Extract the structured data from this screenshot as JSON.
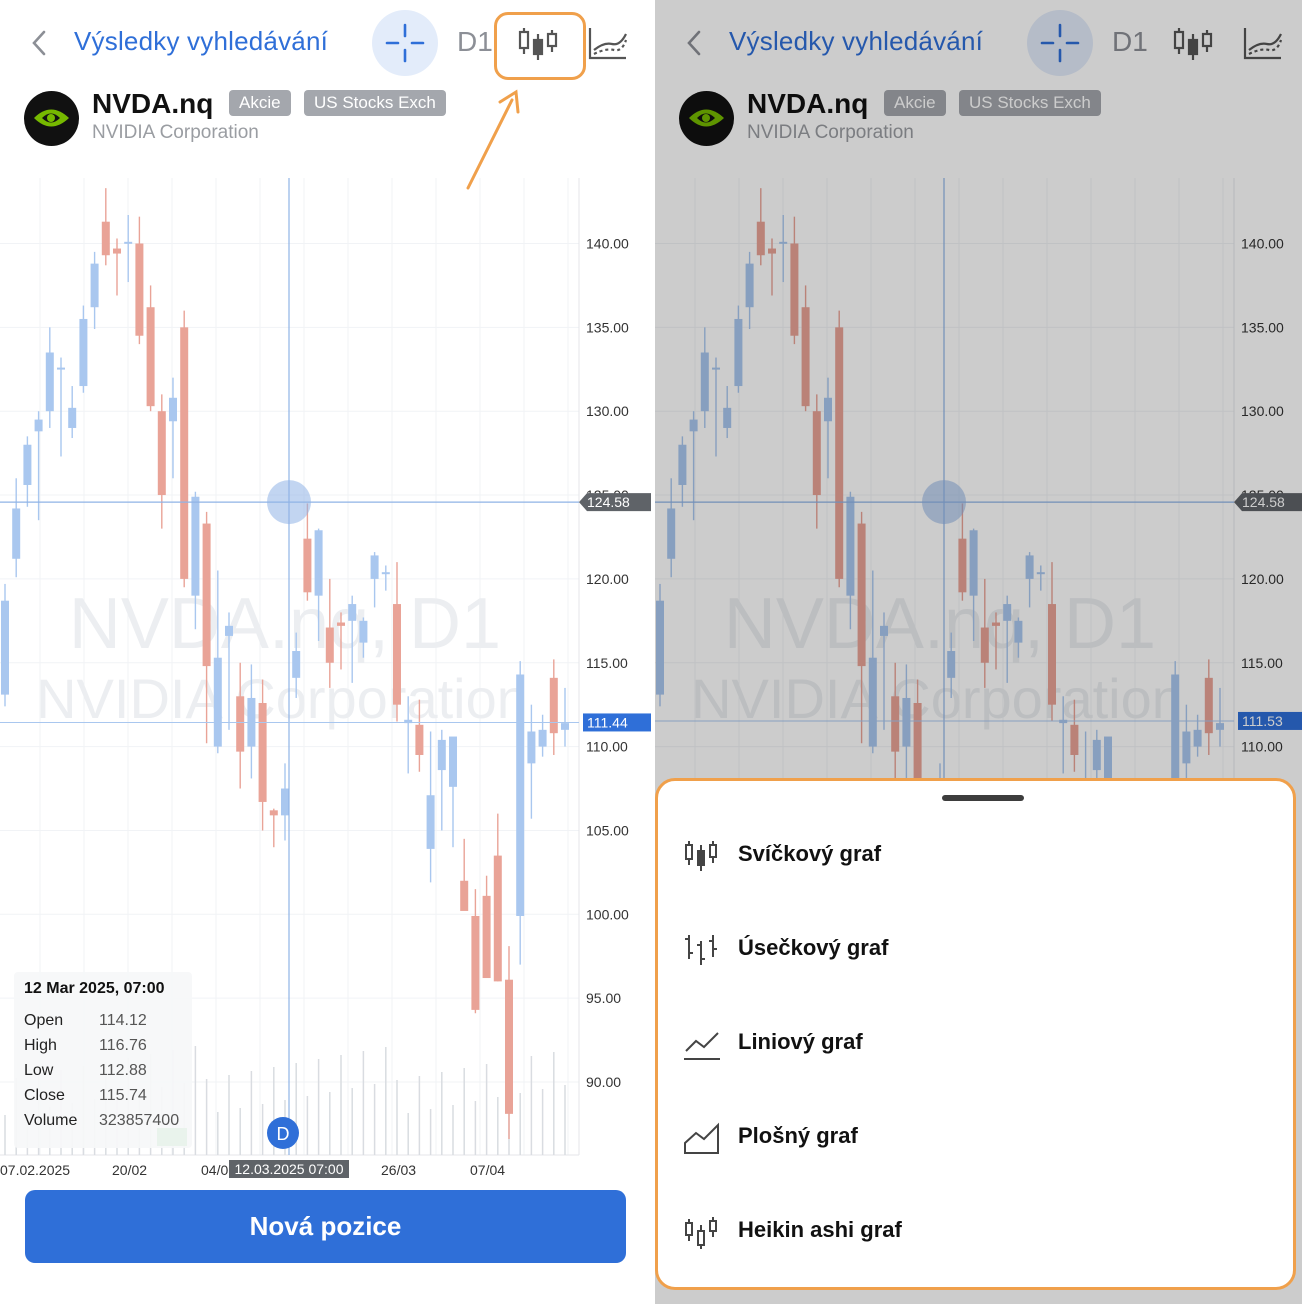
{
  "header": {
    "title": "Výsledky vyhledávání",
    "timeframe": "D1",
    "icons": [
      "chevron-left-icon",
      "crosshair-icon",
      "candlestick-icon",
      "indicators-icon"
    ]
  },
  "symbol": {
    "ticker": "NVDA.nq",
    "tags": [
      "Akcie",
      "US Stocks Exch"
    ],
    "company": "NVIDIA Corporation",
    "logo": "nvidia-logo"
  },
  "watermark": {
    "line1": "NVDA.nq, D1",
    "line2": "NVIDIA Corporation"
  },
  "price_axis": {
    "labels": [
      "140.00",
      "135.00",
      "130.00",
      "125.00",
      "120.00",
      "115.00",
      "110.00",
      "105.00",
      "100.00",
      "95.00",
      "90.00"
    ],
    "crosshair_price": "124.58"
  },
  "current_price_left": "111.44",
  "current_price_right": "111.53",
  "time_axis": {
    "labels": [
      "07.02.2025",
      "20/02",
      "04/0",
      "26/03",
      "07/04"
    ],
    "crosshair_time": "12.03.2025 07:00"
  },
  "dividend_marker": "D",
  "tooltip": {
    "date": "12 Mar 2025, 07:00",
    "rows": [
      {
        "label": "Open",
        "value": "114.12"
      },
      {
        "label": "High",
        "value": "116.76"
      },
      {
        "label": "Low",
        "value": "112.88"
      },
      {
        "label": "Close",
        "value": "115.74"
      },
      {
        "label": "Volume",
        "value": "323857400"
      }
    ]
  },
  "cta": {
    "label": "Nová pozice"
  },
  "chart_type_sheet": {
    "options": [
      {
        "label": "Svíčkový graf",
        "icon": "candlestick-icon"
      },
      {
        "label": "Úsečkový graf",
        "icon": "bar-chart-icon"
      },
      {
        "label": "Liniový graf",
        "icon": "line-chart-icon"
      },
      {
        "label": "Plošný graf",
        "icon": "area-chart-icon"
      },
      {
        "label": "Heikin ashi graf",
        "icon": "heikin-ashi-icon"
      }
    ]
  },
  "colors": {
    "accent": "#2f6fd8",
    "bull": "#a9c7ef",
    "bear": "#e9a397",
    "highlight": "#f0a04b"
  },
  "candles": [
    {
      "o": 113.1,
      "h": 119.7,
      "l": 112.4,
      "c": 118.7
    },
    {
      "o": 121.2,
      "h": 126.0,
      "l": 120.1,
      "c": 124.2
    },
    {
      "o": 125.6,
      "h": 128.5,
      "l": 124.3,
      "c": 128.0
    },
    {
      "o": 128.8,
      "h": 130.0,
      "l": 123.5,
      "c": 129.5
    },
    {
      "o": 130.0,
      "h": 135.0,
      "l": 129.0,
      "c": 133.5
    },
    {
      "o": 132.5,
      "h": 133.2,
      "l": 127.3,
      "c": 132.6
    },
    {
      "o": 129.0,
      "h": 131.5,
      "l": 128.4,
      "c": 130.2
    },
    {
      "o": 131.5,
      "h": 136.3,
      "l": 131.1,
      "c": 135.5
    },
    {
      "o": 136.2,
      "h": 139.5,
      "l": 134.9,
      "c": 138.8
    },
    {
      "o": 141.3,
      "h": 143.3,
      "l": 138.7,
      "c": 139.3
    },
    {
      "o": 139.7,
      "h": 140.3,
      "l": 136.9,
      "c": 139.4
    },
    {
      "o": 140.0,
      "h": 141.7,
      "l": 137.7,
      "c": 140.1
    },
    {
      "o": 140.0,
      "h": 141.6,
      "l": 134.0,
      "c": 134.5
    },
    {
      "o": 136.2,
      "h": 137.5,
      "l": 130.0,
      "c": 130.3
    },
    {
      "o": 130.0,
      "h": 131.0,
      "l": 123.0,
      "c": 125.0
    },
    {
      "o": 129.4,
      "h": 132.0,
      "l": 126.0,
      "c": 130.8
    },
    {
      "o": 135.0,
      "h": 136.0,
      "l": 119.5,
      "c": 120.0
    },
    {
      "o": 119.0,
      "h": 125.2,
      "l": 117.0,
      "c": 124.9
    },
    {
      "o": 123.3,
      "h": 124.0,
      "l": 110.2,
      "c": 114.8
    },
    {
      "o": 110.0,
      "h": 120.5,
      "l": 109.6,
      "c": 115.3
    },
    {
      "o": 116.6,
      "h": 118.0,
      "l": 111.0,
      "c": 117.2
    },
    {
      "o": 113.0,
      "h": 115.0,
      "l": 107.5,
      "c": 109.7
    },
    {
      "o": 110.0,
      "h": 114.9,
      "l": 108.1,
      "c": 112.9
    },
    {
      "o": 112.6,
      "h": 114.0,
      "l": 105.0,
      "c": 106.7
    },
    {
      "o": 106.2,
      "h": 106.3,
      "l": 104.0,
      "c": 105.9
    },
    {
      "o": 105.9,
      "h": 109.0,
      "l": 104.4,
      "c": 107.5
    },
    {
      "o": 114.1,
      "h": 116.8,
      "l": 112.9,
      "c": 115.7
    },
    {
      "o": 122.4,
      "h": 124.5,
      "l": 118.7,
      "c": 119.2
    },
    {
      "o": 119.0,
      "h": 123.0,
      "l": 116.3,
      "c": 122.9
    },
    {
      "o": 117.1,
      "h": 120.0,
      "l": 113.5,
      "c": 115.0
    },
    {
      "o": 117.4,
      "h": 118.0,
      "l": 114.6,
      "c": 117.2
    },
    {
      "o": 117.5,
      "h": 119.0,
      "l": 113.8,
      "c": 118.5
    },
    {
      "o": 116.2,
      "h": 117.7,
      "l": 115.3,
      "c": 117.5
    },
    {
      "o": 120.0,
      "h": 121.6,
      "l": 118.3,
      "c": 121.4
    },
    {
      "o": 120.3,
      "h": 120.8,
      "l": 119.3,
      "c": 120.4
    },
    {
      "o": 118.5,
      "h": 121.0,
      "l": 111.5,
      "c": 112.5
    },
    {
      "o": 111.4,
      "h": 113.0,
      "l": 108.4,
      "c": 111.6
    },
    {
      "o": 111.3,
      "h": 112.8,
      "l": 108.5,
      "c": 109.5
    },
    {
      "o": 103.9,
      "h": 110.9,
      "l": 101.9,
      "c": 107.1
    },
    {
      "o": 108.6,
      "h": 111.0,
      "l": 105.0,
      "c": 110.4
    },
    {
      "o": 107.6,
      "h": 110.3,
      "l": 104.0,
      "c": 110.6
    },
    {
      "o": 102.0,
      "h": 104.5,
      "l": 101.2,
      "c": 100.2
    },
    {
      "o": 99.9,
      "h": 101.5,
      "l": 94.1,
      "c": 94.3
    },
    {
      "o": 101.1,
      "h": 102.3,
      "l": 96.4,
      "c": 96.2
    },
    {
      "o": 103.5,
      "h": 106.0,
      "l": 96.0,
      "c": 96.0
    },
    {
      "o": 96.1,
      "h": 98.1,
      "l": 86.6,
      "c": 88.1
    },
    {
      "o": 99.9,
      "h": 115.1,
      "l": 97.0,
      "c": 114.3
    },
    {
      "o": 109.0,
      "h": 112.5,
      "l": 105.7,
      "c": 110.9
    },
    {
      "o": 110.0,
      "h": 111.9,
      "l": 109.4,
      "c": 111.0
    },
    {
      "o": 114.1,
      "h": 115.2,
      "l": 109.5,
      "c": 110.8
    },
    {
      "o": 111.0,
      "h": 113.5,
      "l": 110.0,
      "c": 111.4
    }
  ]
}
